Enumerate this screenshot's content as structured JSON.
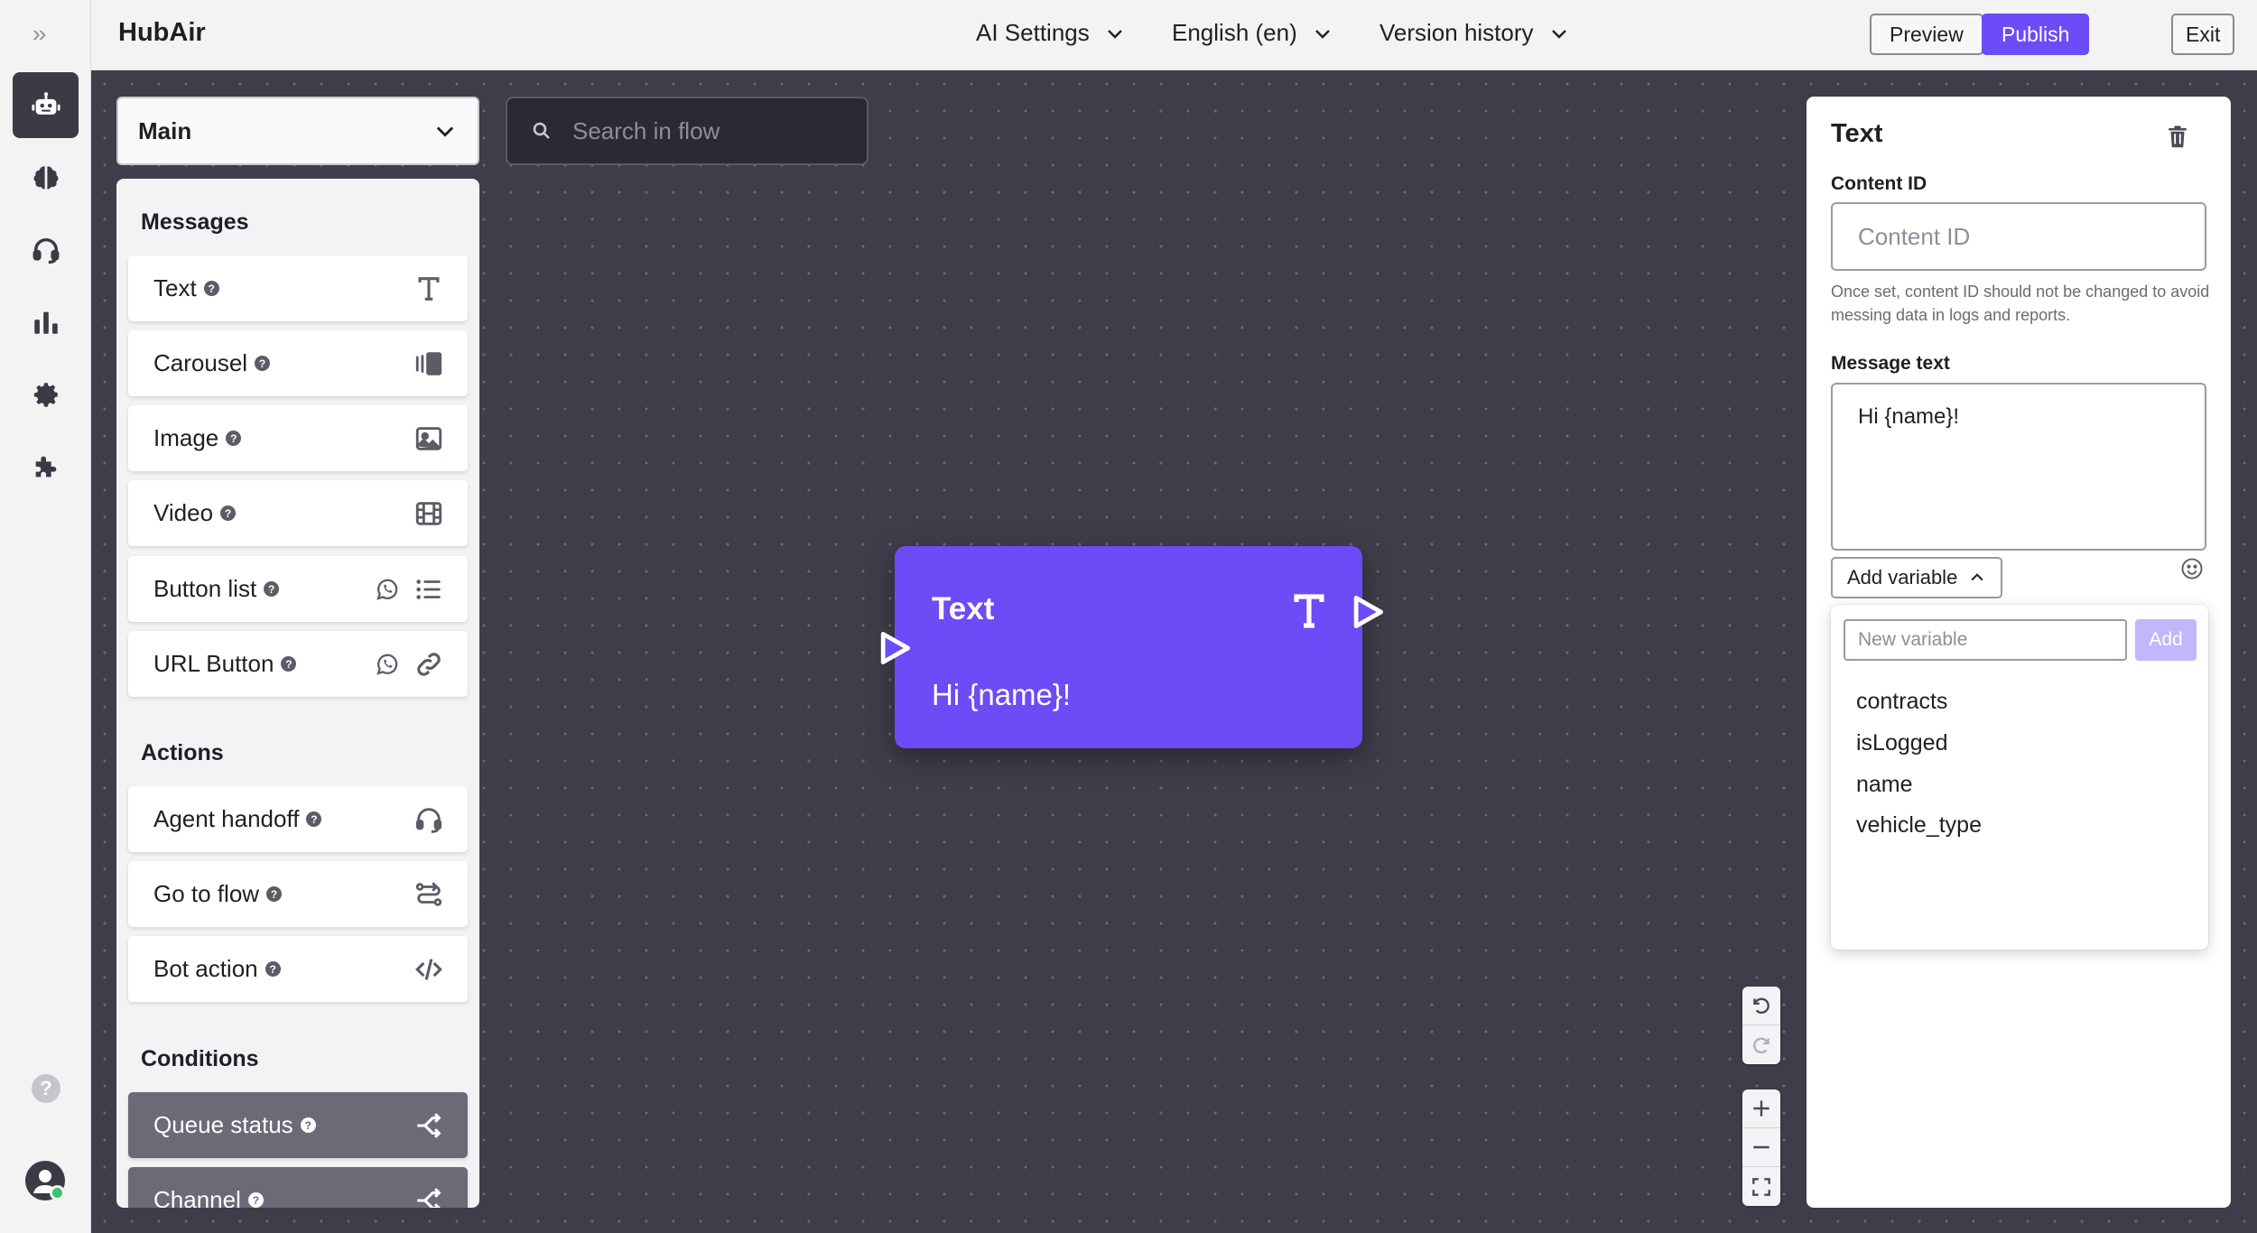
{
  "app": {
    "title": "HubAir"
  },
  "topbar": {
    "ai_settings": "AI Settings",
    "language": "English (en)",
    "version_history": "Version history",
    "preview": "Preview",
    "publish": "Publish",
    "exit": "Exit"
  },
  "rail": {
    "icons": [
      "bot-icon",
      "brain-icon",
      "headset-icon",
      "chart-icon",
      "gear-icon",
      "puzzle-icon"
    ],
    "help": "?"
  },
  "flow": {
    "selected": "Main"
  },
  "search": {
    "placeholder": "Search in flow"
  },
  "palette": {
    "messages_title": "Messages",
    "messages": [
      {
        "label": "Text",
        "icon": "text-icon"
      },
      {
        "label": "Carousel",
        "icon": "carousel-icon"
      },
      {
        "label": "Image",
        "icon": "image-icon"
      },
      {
        "label": "Video",
        "icon": "video-icon"
      },
      {
        "label": "Button list",
        "icon": "list-icon"
      },
      {
        "label": "URL Button",
        "icon": "link-icon"
      }
    ],
    "actions_title": "Actions",
    "actions": [
      {
        "label": "Agent handoff",
        "icon": "headset-icon"
      },
      {
        "label": "Go to flow",
        "icon": "route-icon"
      },
      {
        "label": "Bot action",
        "icon": "code-icon"
      }
    ],
    "conditions_title": "Conditions",
    "conditions": [
      {
        "label": "Queue status",
        "icon": "split-icon"
      },
      {
        "label": "Channel",
        "icon": "split-icon"
      }
    ]
  },
  "node": {
    "title": "Text",
    "text": "Hi {name}!"
  },
  "panel": {
    "title": "Text",
    "content_id_label": "Content ID",
    "content_id_placeholder": "Content ID",
    "content_id_hint": "Once set, content ID should not be changed to avoid messing data in logs and reports.",
    "message_text_label": "Message text",
    "message_text_value": "Hi {name}!",
    "add_variable": "Add variable",
    "new_variable_placeholder": "New variable",
    "add_button": "Add",
    "variables": [
      "contracts",
      "isLogged",
      "name",
      "vehicle_type"
    ]
  },
  "colors": {
    "accent": "#6b4cf6",
    "canvas": "#3e3d49",
    "condition_item": "#6b6a77"
  }
}
